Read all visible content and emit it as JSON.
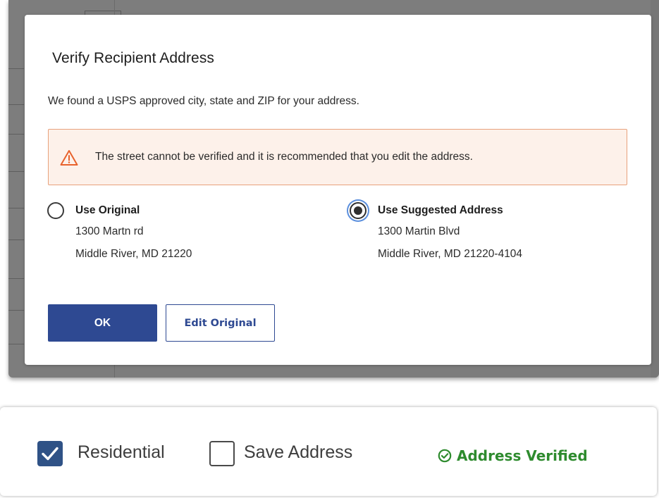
{
  "modal": {
    "title": "Verify Recipient Address",
    "subtitle": "We found a USPS approved city, state and ZIP for your address.",
    "alert": {
      "icon": "warning-triangle-icon",
      "text": "The street cannot be verified and it is recommended that you edit the address.",
      "color": "#e8622c"
    },
    "options": {
      "original": {
        "title": "Use Original",
        "line1": "1300 Martn rd",
        "line2": "Middle River, MD 21220",
        "selected": false
      },
      "suggested": {
        "title": "Use Suggested Address",
        "line1": "1300 Martin Blvd",
        "line2": "Middle River, MD 21220-4104",
        "selected": true
      }
    },
    "buttons": {
      "ok": "OK",
      "edit": "Edit Original"
    },
    "colors": {
      "primary": "#2e4992",
      "alert_border": "#e8a17b",
      "alert_bg": "#fdf1ea"
    }
  },
  "address_options": {
    "residential": {
      "label": "Residential",
      "checked": true
    },
    "save_address": {
      "label": "Save Address",
      "checked": false
    },
    "status": {
      "icon": "check-circle-icon",
      "text": "Address Verified",
      "color": "#2e8b2e"
    }
  }
}
